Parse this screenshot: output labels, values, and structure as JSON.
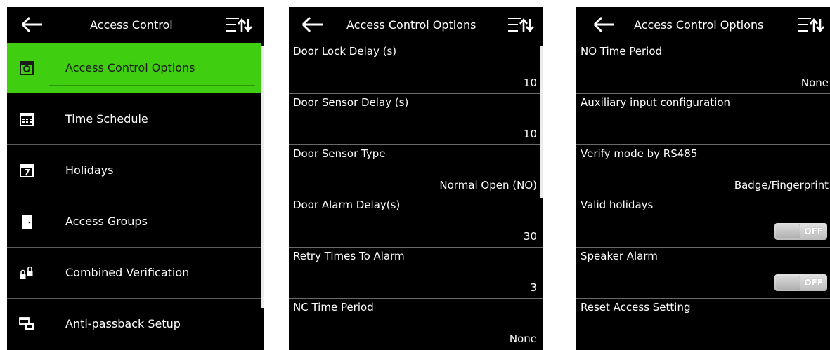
{
  "panel1": {
    "title": "Access Control",
    "items": [
      {
        "label": "Access Control Options",
        "icon": "options-icon"
      },
      {
        "label": "Time Schedule",
        "icon": "calendar-icon"
      },
      {
        "label": "Holidays",
        "icon": "holiday-calendar-icon"
      },
      {
        "label": "Access Groups",
        "icon": "door-icon"
      },
      {
        "label": "Combined Verification",
        "icon": "locks-icon"
      },
      {
        "label": "Anti-passback Setup",
        "icon": "anti-passback-icon"
      }
    ]
  },
  "panel2": {
    "title": "Access Control Options",
    "rows": [
      {
        "label": "Door Lock Delay (s)",
        "value": "10"
      },
      {
        "label": "Door Sensor Delay (s)",
        "value": "10"
      },
      {
        "label": "Door Sensor Type",
        "value": "Normal Open (NO)"
      },
      {
        "label": "Door Alarm Delay(s)",
        "value": "30"
      },
      {
        "label": "Retry Times To Alarm",
        "value": "3"
      },
      {
        "label": "NC Time Period",
        "value": "None"
      }
    ]
  },
  "panel3": {
    "title": "Access Control Options",
    "rows": [
      {
        "label": "NO Time Period",
        "value": "None"
      },
      {
        "label": "Auxiliary input configuration",
        "value": ""
      },
      {
        "label": "Verify mode by RS485",
        "value": "Badge/Fingerprint"
      },
      {
        "label": "Valid holidays",
        "toggle": "OFF"
      },
      {
        "label": "Speaker Alarm",
        "toggle": "OFF"
      },
      {
        "label": "Reset Access Setting",
        "value": ""
      }
    ]
  },
  "colors": {
    "accent": "#3fce10",
    "background": "#000000"
  }
}
